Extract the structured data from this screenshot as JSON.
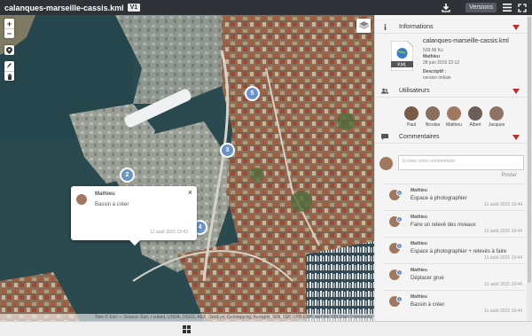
{
  "app": {
    "filename": "calanques-marseille-cassis.kml",
    "version_badge": "V1",
    "versions_label": "Versions"
  },
  "colors": {
    "topbar": "#2f3338",
    "marker": "#6b93c8",
    "chevron": "#b5302c"
  },
  "map": {
    "zoom_in": "+",
    "zoom_out": "−",
    "attribution": "Tiles © Esri — Source: Esri, i-cubed, USDA, USGS, AEX, GeoEye, Getmapping, Aerogrid, IGN, IGP, UPR-EGP, and the GIS User Community",
    "markers": [
      {
        "number": "5"
      },
      {
        "number": "3"
      },
      {
        "number": "2"
      },
      {
        "number": "4"
      },
      {
        "number": ""
      }
    ],
    "popup": {
      "author": "Mathieu",
      "text": "Bassin à créer",
      "date": "11 août 2015 19:42",
      "close": "×"
    }
  },
  "panel": {
    "informations": {
      "title": "Informations",
      "file_name": "calanques-marseille-cassis.kml",
      "file_type": "KML",
      "size": "539.06 Ko",
      "author": "Mathieu",
      "date": "28 juin 2015 22:12",
      "desc_label": "Descriptif :",
      "desc": "version initiale"
    },
    "users": {
      "title": "Utilisateurs",
      "list": [
        {
          "name": "Paul",
          "color": "#7a5a48"
        },
        {
          "name": "Nicolas",
          "color": "#8a6f5f"
        },
        {
          "name": "Mathieu",
          "color": "#a07860"
        },
        {
          "name": "Albert",
          "color": "#6b5d57"
        },
        {
          "name": "Jacques",
          "color": "#8e7263"
        }
      ]
    },
    "comments": {
      "title": "Commentaires",
      "placeholder": "Ecrivez votre commentaire",
      "post_label": "Poster",
      "items": [
        {
          "num": "5",
          "author": "Mathieu",
          "text": "Espace à photographier",
          "date": "11 août 2015 19:44"
        },
        {
          "num": "4",
          "author": "Mathieu",
          "text": "Faire un relevé des niveaux",
          "date": "11 août 2015 19:44"
        },
        {
          "num": "3",
          "author": "Mathieu",
          "text": "Espace à photographier + relevés à faire",
          "date": "11 août 2015 19:44"
        },
        {
          "num": "2",
          "author": "Mathieu",
          "text": "Déplacer grue",
          "date": "11 août 2015 19:44"
        },
        {
          "num": "1",
          "author": "Mathieu",
          "text": "Bassin à créer",
          "date": "11 août 2015 19:44"
        }
      ]
    },
    "next_section": "Versions"
  }
}
